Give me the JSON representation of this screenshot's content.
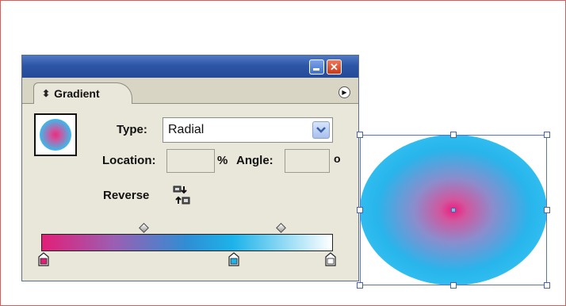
{
  "panel": {
    "tab_title": "Gradient",
    "type_label": "Type:",
    "type_value": "Radial",
    "location_label": "Location:",
    "location_value": "",
    "percent_symbol": "%",
    "angle_label": "Angle:",
    "angle_value": "",
    "degree_symbol": "o",
    "reverse_label": "Reverse"
  },
  "gradient": {
    "stops": [
      {
        "color": "#e21f78",
        "position": 0
      },
      {
        "color": "#1db3ea",
        "position": 66
      },
      {
        "color": "#ffffff",
        "position": 100
      }
    ],
    "midpoints": [
      35,
      82
    ]
  },
  "colors": {
    "titlebar": "#2d56a6",
    "panel_bg": "#e9e6da",
    "pink": "#e21f78",
    "cyan": "#1db3ea"
  },
  "icons": [
    "minimize-icon",
    "close-icon",
    "panel-menu-icon",
    "reverse-icon",
    "dropdown-chevron-icon"
  ]
}
